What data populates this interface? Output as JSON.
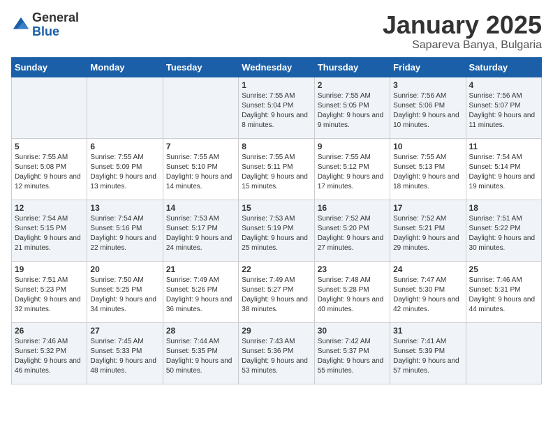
{
  "logo": {
    "general": "General",
    "blue": "Blue"
  },
  "title": "January 2025",
  "subtitle": "Sapareva Banya, Bulgaria",
  "days_of_week": [
    "Sunday",
    "Monday",
    "Tuesday",
    "Wednesday",
    "Thursday",
    "Friday",
    "Saturday"
  ],
  "weeks": [
    [
      {
        "day": "",
        "info": ""
      },
      {
        "day": "",
        "info": ""
      },
      {
        "day": "",
        "info": ""
      },
      {
        "day": "1",
        "info": "Sunrise: 7:55 AM\nSunset: 5:04 PM\nDaylight: 9 hours and 8 minutes."
      },
      {
        "day": "2",
        "info": "Sunrise: 7:55 AM\nSunset: 5:05 PM\nDaylight: 9 hours and 9 minutes."
      },
      {
        "day": "3",
        "info": "Sunrise: 7:56 AM\nSunset: 5:06 PM\nDaylight: 9 hours and 10 minutes."
      },
      {
        "day": "4",
        "info": "Sunrise: 7:56 AM\nSunset: 5:07 PM\nDaylight: 9 hours and 11 minutes."
      }
    ],
    [
      {
        "day": "5",
        "info": "Sunrise: 7:55 AM\nSunset: 5:08 PM\nDaylight: 9 hours and 12 minutes."
      },
      {
        "day": "6",
        "info": "Sunrise: 7:55 AM\nSunset: 5:09 PM\nDaylight: 9 hours and 13 minutes."
      },
      {
        "day": "7",
        "info": "Sunrise: 7:55 AM\nSunset: 5:10 PM\nDaylight: 9 hours and 14 minutes."
      },
      {
        "day": "8",
        "info": "Sunrise: 7:55 AM\nSunset: 5:11 PM\nDaylight: 9 hours and 15 minutes."
      },
      {
        "day": "9",
        "info": "Sunrise: 7:55 AM\nSunset: 5:12 PM\nDaylight: 9 hours and 17 minutes."
      },
      {
        "day": "10",
        "info": "Sunrise: 7:55 AM\nSunset: 5:13 PM\nDaylight: 9 hours and 18 minutes."
      },
      {
        "day": "11",
        "info": "Sunrise: 7:54 AM\nSunset: 5:14 PM\nDaylight: 9 hours and 19 minutes."
      }
    ],
    [
      {
        "day": "12",
        "info": "Sunrise: 7:54 AM\nSunset: 5:15 PM\nDaylight: 9 hours and 21 minutes."
      },
      {
        "day": "13",
        "info": "Sunrise: 7:54 AM\nSunset: 5:16 PM\nDaylight: 9 hours and 22 minutes."
      },
      {
        "day": "14",
        "info": "Sunrise: 7:53 AM\nSunset: 5:17 PM\nDaylight: 9 hours and 24 minutes."
      },
      {
        "day": "15",
        "info": "Sunrise: 7:53 AM\nSunset: 5:19 PM\nDaylight: 9 hours and 25 minutes."
      },
      {
        "day": "16",
        "info": "Sunrise: 7:52 AM\nSunset: 5:20 PM\nDaylight: 9 hours and 27 minutes."
      },
      {
        "day": "17",
        "info": "Sunrise: 7:52 AM\nSunset: 5:21 PM\nDaylight: 9 hours and 29 minutes."
      },
      {
        "day": "18",
        "info": "Sunrise: 7:51 AM\nSunset: 5:22 PM\nDaylight: 9 hours and 30 minutes."
      }
    ],
    [
      {
        "day": "19",
        "info": "Sunrise: 7:51 AM\nSunset: 5:23 PM\nDaylight: 9 hours and 32 minutes."
      },
      {
        "day": "20",
        "info": "Sunrise: 7:50 AM\nSunset: 5:25 PM\nDaylight: 9 hours and 34 minutes."
      },
      {
        "day": "21",
        "info": "Sunrise: 7:49 AM\nSunset: 5:26 PM\nDaylight: 9 hours and 36 minutes."
      },
      {
        "day": "22",
        "info": "Sunrise: 7:49 AM\nSunset: 5:27 PM\nDaylight: 9 hours and 38 minutes."
      },
      {
        "day": "23",
        "info": "Sunrise: 7:48 AM\nSunset: 5:28 PM\nDaylight: 9 hours and 40 minutes."
      },
      {
        "day": "24",
        "info": "Sunrise: 7:47 AM\nSunset: 5:30 PM\nDaylight: 9 hours and 42 minutes."
      },
      {
        "day": "25",
        "info": "Sunrise: 7:46 AM\nSunset: 5:31 PM\nDaylight: 9 hours and 44 minutes."
      }
    ],
    [
      {
        "day": "26",
        "info": "Sunrise: 7:46 AM\nSunset: 5:32 PM\nDaylight: 9 hours and 46 minutes."
      },
      {
        "day": "27",
        "info": "Sunrise: 7:45 AM\nSunset: 5:33 PM\nDaylight: 9 hours and 48 minutes."
      },
      {
        "day": "28",
        "info": "Sunrise: 7:44 AM\nSunset: 5:35 PM\nDaylight: 9 hours and 50 minutes."
      },
      {
        "day": "29",
        "info": "Sunrise: 7:43 AM\nSunset: 5:36 PM\nDaylight: 9 hours and 53 minutes."
      },
      {
        "day": "30",
        "info": "Sunrise: 7:42 AM\nSunset: 5:37 PM\nDaylight: 9 hours and 55 minutes."
      },
      {
        "day": "31",
        "info": "Sunrise: 7:41 AM\nSunset: 5:39 PM\nDaylight: 9 hours and 57 minutes."
      },
      {
        "day": "",
        "info": ""
      }
    ]
  ]
}
